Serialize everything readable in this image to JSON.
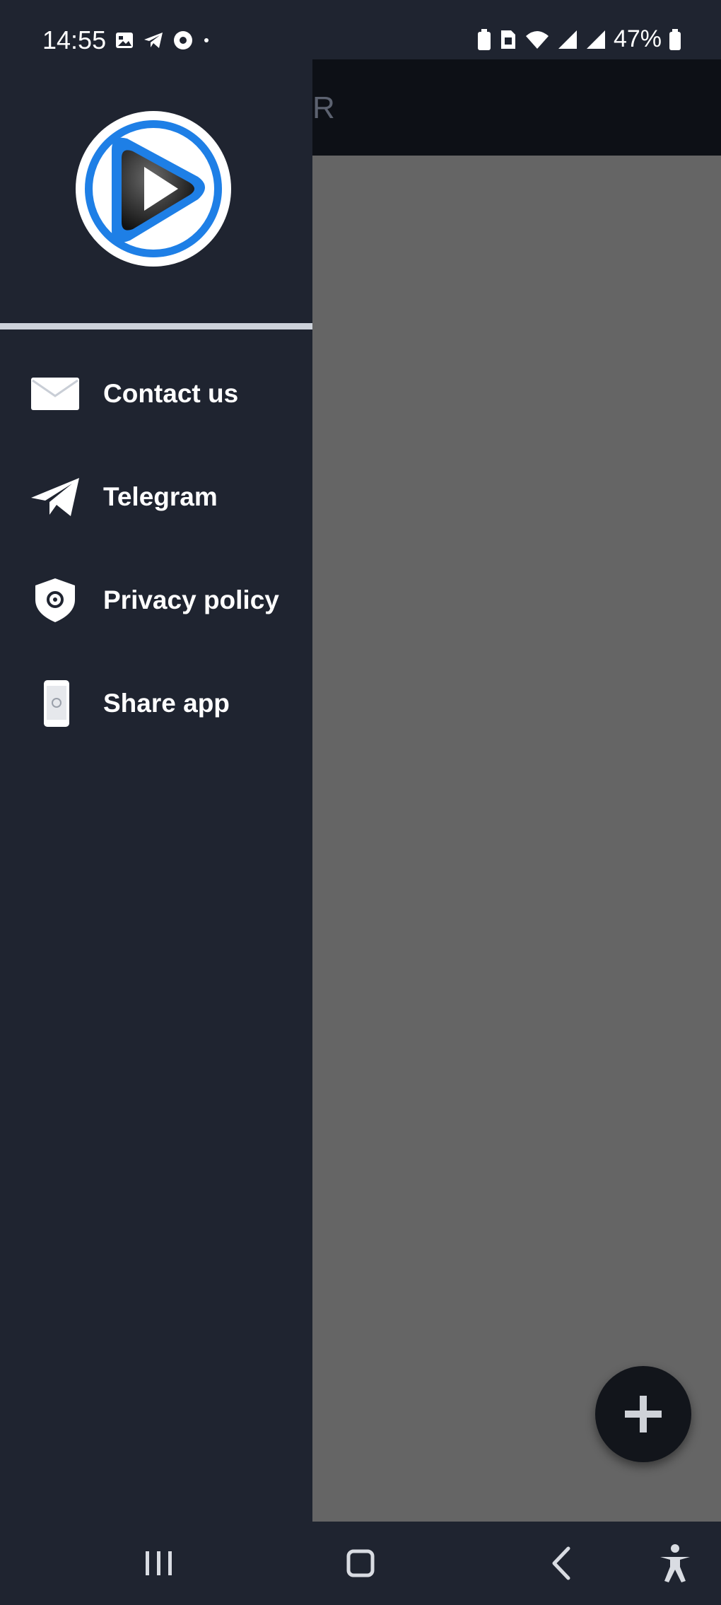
{
  "status_bar": {
    "time": "14:55",
    "battery_percent": "47%",
    "left_icons": [
      "gallery-icon",
      "telegram-icon",
      "settings-icon",
      "dot-icon"
    ],
    "right_icons": [
      "battery-saver-icon",
      "sim-icon",
      "wifi-icon",
      "signal-icon",
      "signal-icon",
      "battery-icon"
    ]
  },
  "background_app": {
    "toolbar_title_fragment": "R",
    "fab_icon": "plus-icon"
  },
  "drawer": {
    "logo_icon": "play-logo-icon",
    "menu": [
      {
        "label": "Contact us",
        "icon": "mail-icon"
      },
      {
        "label": "Telegram",
        "icon": "telegram-plane-icon"
      },
      {
        "label": "Privacy policy",
        "icon": "privacy-shield-icon"
      },
      {
        "label": "Share app",
        "icon": "phone-share-icon"
      }
    ]
  },
  "nav_bar": {
    "buttons": [
      "recents-icon",
      "home-icon",
      "back-icon",
      "accessibility-icon"
    ]
  },
  "colors": {
    "drawer_bg": "#1f2430",
    "content_bg": "#656565",
    "toolbar_bg": "#0d1016",
    "logo_blue": "#1e7fe6"
  }
}
